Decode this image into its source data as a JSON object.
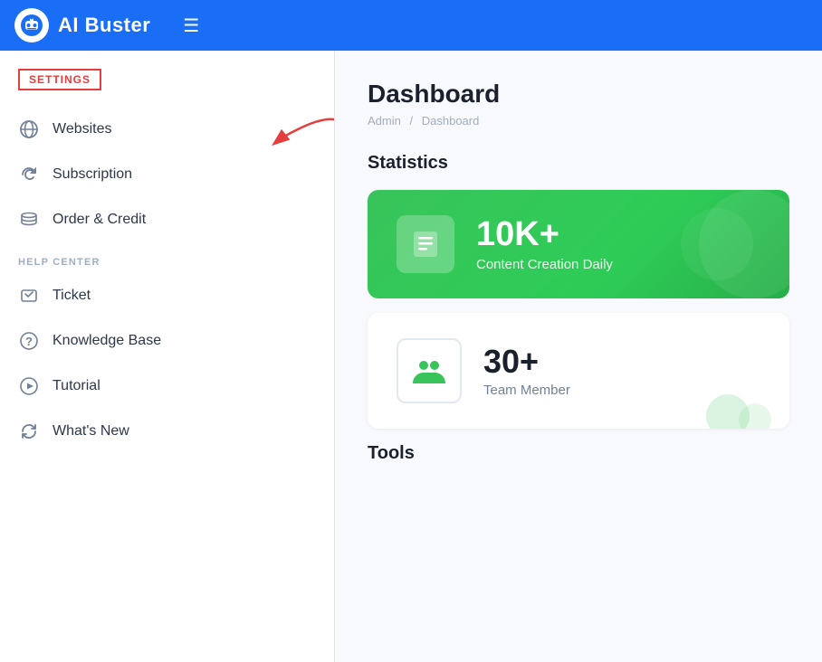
{
  "header": {
    "logo_text": "AI Buster",
    "hamburger_icon": "☰"
  },
  "sidebar": {
    "settings_label": "SETTINGS",
    "items_settings": [
      {
        "id": "websites",
        "label": "Websites",
        "icon": "globe"
      },
      {
        "id": "subscription",
        "label": "Subscription",
        "icon": "refresh"
      },
      {
        "id": "order-credit",
        "label": "Order & Credit",
        "icon": "stack"
      }
    ],
    "help_center_label": "HELP CENTER",
    "items_help": [
      {
        "id": "ticket",
        "label": "Ticket",
        "icon": "ticket"
      },
      {
        "id": "knowledge-base",
        "label": "Knowledge Base",
        "icon": "question"
      },
      {
        "id": "tutorial",
        "label": "Tutorial",
        "icon": "video"
      },
      {
        "id": "whats-new",
        "label": "What's New",
        "icon": "refresh-cw"
      }
    ]
  },
  "main": {
    "page_title": "Dashboard",
    "breadcrumb_admin": "Admin",
    "breadcrumb_separator": "/",
    "breadcrumb_current": "Dashboard",
    "statistics_title": "Statistics",
    "card1": {
      "number": "10K+",
      "label": "Content Creation Daily"
    },
    "card2": {
      "number": "30+",
      "label": "Team Member"
    },
    "tools_title": "Tools"
  }
}
